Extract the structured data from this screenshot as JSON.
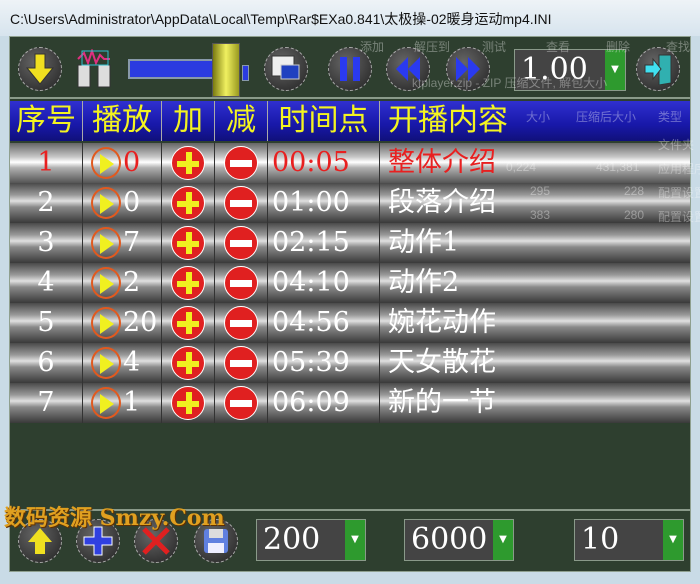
{
  "window": {
    "title": "C:\\Users\\Administrator\\AppData\\Local\\Temp\\Rar$EXa0.841\\太极操-02暖身运动mp4.INI"
  },
  "toolbar": {
    "speed_value": "1.00",
    "slider_level": 0.85
  },
  "table": {
    "headers": [
      "序号",
      "播放",
      "加",
      "减",
      "时间点",
      "开播内容"
    ],
    "rows": [
      {
        "no": "1",
        "count": "0",
        "time": "00:05",
        "content": "整体介绍",
        "selected": true
      },
      {
        "no": "2",
        "count": "0",
        "time": "01:00",
        "content": "段落介绍"
      },
      {
        "no": "3",
        "count": "7",
        "time": "02:15",
        "content": "动作1"
      },
      {
        "no": "4",
        "count": "2",
        "time": "04:10",
        "content": "动作2"
      },
      {
        "no": "5",
        "count": "20",
        "time": "04:56",
        "content": "婉花动作"
      },
      {
        "no": "6",
        "count": "4",
        "time": "05:39",
        "content": "天女散花"
      },
      {
        "no": "7",
        "count": "1",
        "time": "06:09",
        "content": "新的一节"
      }
    ]
  },
  "bottom": {
    "combo1": "200",
    "combo2": "6000",
    "combo3": "10"
  },
  "watermark": "数码资源 Smzy.Com",
  "background_window": {
    "toolbar": [
      "添加",
      "解压到",
      "测试",
      "查看",
      "删除",
      "查找"
    ],
    "path": "ktplayer.zip - ZIP 压缩文件, 解包大小",
    "columns": [
      "大小",
      "压缩后大小",
      "类型"
    ],
    "rows": [
      [
        "文件夹"
      ],
      [
        "0,224",
        "431,381",
        "应用程序"
      ],
      [
        "295",
        "228",
        "配置设置"
      ],
      [
        "383",
        "280",
        "配置设置"
      ]
    ]
  },
  "colors": {
    "panel": "#2e3f2f",
    "header": "#1818a8",
    "header_text": "#f4f420",
    "selected_text": "#e82020",
    "dropdown": "#2e9a2e"
  }
}
